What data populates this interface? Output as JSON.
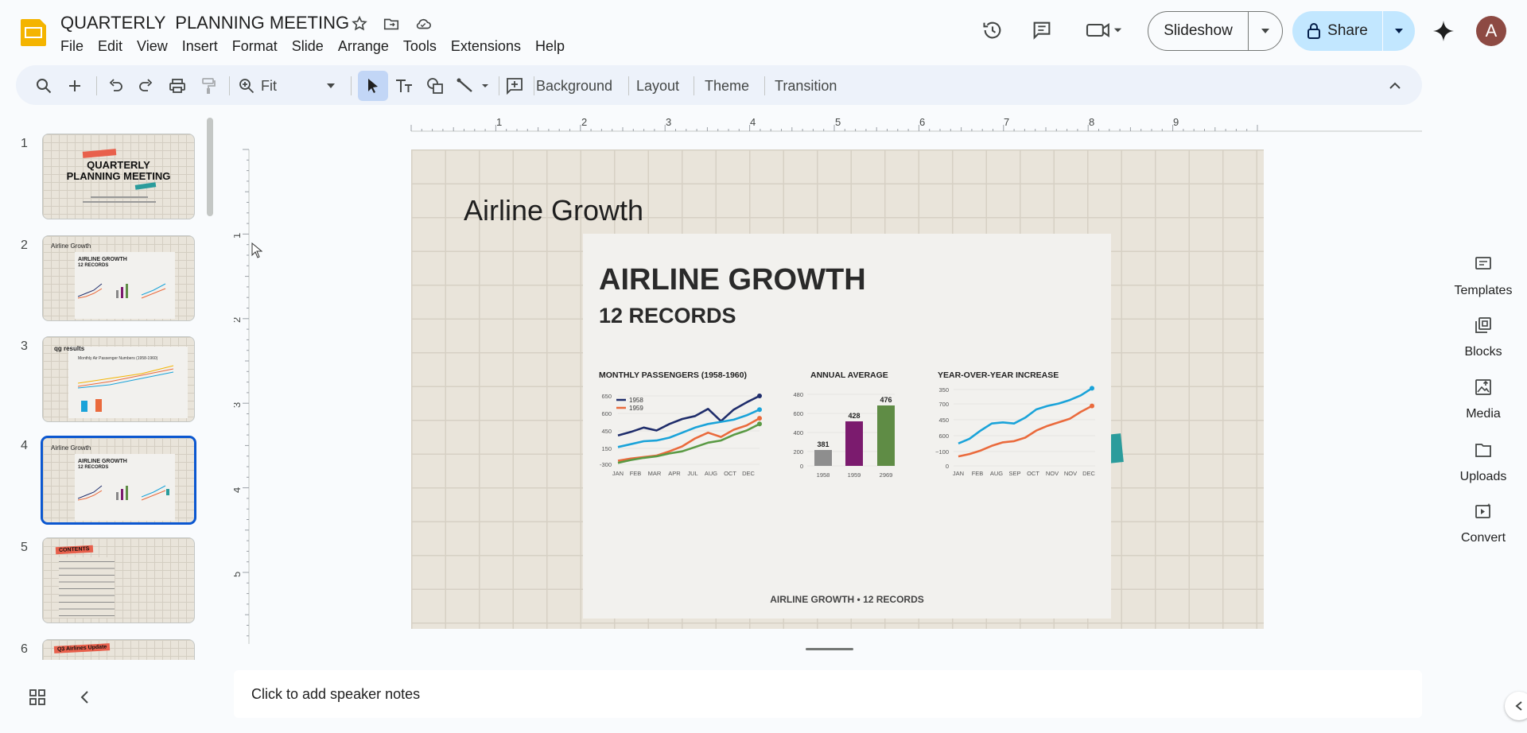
{
  "app": {
    "doc_title": "QUARTERLY  PLANNING MEETING",
    "menu": [
      "File",
      "Edit",
      "View",
      "Insert",
      "Format",
      "Slide",
      "Arrange",
      "Tools",
      "Extensions",
      "Help"
    ],
    "slideshow_label": "Slideshow",
    "share_label": "Share",
    "avatar_initial": "A",
    "accent_color": "#0b57d0",
    "share_bg": "#c2e7ff"
  },
  "toolbar": {
    "zoom_value": "Fit",
    "background_label": "Background",
    "layout_label": "Layout",
    "theme_label": "Theme",
    "transition_label": "Transition"
  },
  "filmstrip": {
    "selected_index": 4,
    "slides": [
      {
        "num": "1",
        "title_line1": "QUARTERLY",
        "title_line2": "PLANNING MEETING"
      },
      {
        "num": "2",
        "header": "Airline Growth",
        "title": "AIRLINE GROWTH",
        "subtitle": "12 RECORDS"
      },
      {
        "num": "3",
        "header": "qg results",
        "title": "qg results",
        "subtitle": "Monthly Air Passenger Numbers (1958-1960)"
      },
      {
        "num": "4",
        "header": "Airline Growth",
        "title": "AIRLINE GROWTH",
        "subtitle": "12 RECORDS"
      },
      {
        "num": "5",
        "header": "CONTENTS"
      },
      {
        "num": "6",
        "header": "Q3 Airlines Update"
      }
    ]
  },
  "rulers": {
    "h_labels": [
      "1",
      "2",
      "3",
      "4",
      "5",
      "6",
      "7",
      "8",
      "9"
    ],
    "v_labels": [
      "1",
      "2",
      "3",
      "4",
      "5"
    ]
  },
  "slide": {
    "title": "Airline Growth",
    "inner_title": "AIRLINE GROWTH",
    "inner_subtitle": "12 RECORDS",
    "footer": "AIRLINE GROWTH • 12 RECORDS"
  },
  "chart_data": [
    {
      "type": "line",
      "title": "MONTHLY PASSENGERS (1958-1960)",
      "categories": [
        "JAN",
        "FEB",
        "MAR",
        "APR",
        "JUL",
        "AUG",
        "OCT",
        "DEC"
      ],
      "y_ticks": [
        "650",
        "600",
        "450",
        "150",
        "-300"
      ],
      "series": [
        {
          "name": "1958",
          "color": "#1f2d6b",
          "values": [
            100,
            150,
            210,
            170,
            260,
            330,
            370,
            470,
            300,
            460,
            560,
            650
          ]
        },
        {
          "name": "1959",
          "color": "#ea6a3c",
          "values": [
            -250,
            -220,
            -200,
            -180,
            -120,
            -50,
            60,
            140,
            80,
            180,
            240,
            340
          ]
        },
        {
          "color": "#1aa3d9",
          "values": [
            -60,
            -20,
            20,
            30,
            70,
            140,
            210,
            260,
            290,
            320,
            380,
            460
          ]
        },
        {
          "color": "#5a9a44",
          "values": [
            -280,
            -240,
            -210,
            -190,
            -150,
            -120,
            -60,
            0,
            30,
            110,
            170,
            260
          ]
        }
      ]
    },
    {
      "type": "bar",
      "title": "ANNUAL AVERAGE",
      "categories": [
        "1958",
        "1959",
        "2969"
      ],
      "values": [
        381,
        428,
        476
      ],
      "colors": [
        "#8e8e8e",
        "#7b1b6e",
        "#5f8c45"
      ],
      "y_ticks": [
        "480",
        "600",
        "400",
        "200",
        "0"
      ]
    },
    {
      "type": "line",
      "title": "YEAR-OVER-YEAR INCREASE",
      "categories": [
        "JAN",
        "FEB",
        "AUG",
        "SEP",
        "OCT",
        "NOV",
        "NOV",
        "DEC"
      ],
      "y_ticks": [
        "350",
        "700",
        "450",
        "600",
        "~100",
        "0"
      ],
      "series": [
        {
          "color": "#1aa3d9",
          "values": [
            150,
            190,
            260,
            320,
            330,
            320,
            370,
            440,
            470,
            490,
            520,
            560,
            620
          ]
        },
        {
          "color": "#ea6a3c",
          "values": [
            40,
            60,
            90,
            130,
            160,
            170,
            200,
            260,
            300,
            330,
            360,
            420,
            470
          ]
        }
      ]
    }
  ],
  "notes": {
    "placeholder": "Click to add speaker notes"
  },
  "side_panel": [
    "Templates",
    "Blocks",
    "Media",
    "Uploads",
    "Convert"
  ]
}
